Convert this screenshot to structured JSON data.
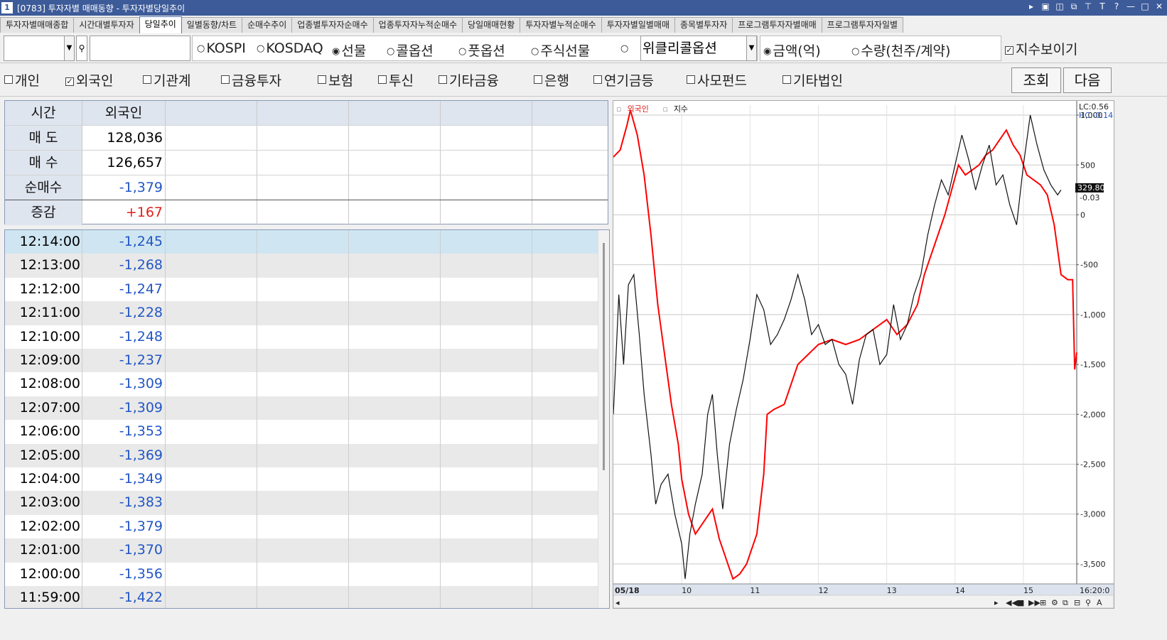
{
  "window": {
    "icon_label": "1",
    "title": "[0783] 투자자별 매매동향 - 투자자별당일추이",
    "controls": [
      "▸",
      "▣",
      "◫",
      "⧉",
      "⊤",
      "T",
      "?",
      "—",
      "□",
      "✕"
    ]
  },
  "tabs": [
    "투자자별매매종합",
    "시간대별투자자",
    "당일추이",
    "일별동향/차트",
    "순매수추이",
    "업종별투자자순매수",
    "업종투자자누적순매수",
    "당일매매현황",
    "투자자별누적순매수",
    "투자자별일별매매",
    "종목별투자자",
    "프로그램투자자별매매",
    "프로그램투자자일별"
  ],
  "active_tab": 2,
  "market": {
    "code_value": "",
    "name_value": "",
    "options": [
      "KOSPI",
      "KOSDAQ",
      "선물",
      "콜옵션",
      "풋옵션",
      "주식선물",
      ""
    ],
    "selected": "선물",
    "product_select": "위클리콜옵션",
    "unit_options": [
      "금액(억)",
      "수량(천주/계약)"
    ],
    "unit_selected": "금액(억)",
    "show_index_label": "지수보이기",
    "show_index_checked": true
  },
  "investors": {
    "items": [
      {
        "label": "개인",
        "checked": false
      },
      {
        "label": "외국인",
        "checked": true
      },
      {
        "label": "기관계",
        "checked": false
      },
      {
        "label": "금융투자",
        "checked": false
      },
      {
        "label": "보험",
        "checked": false
      },
      {
        "label": "투신",
        "checked": false
      },
      {
        "label": "기타금융",
        "checked": false
      },
      {
        "label": "은행",
        "checked": false
      },
      {
        "label": "연기금등",
        "checked": false
      },
      {
        "label": "사모펀드",
        "checked": false
      },
      {
        "label": "기타법인",
        "checked": false
      }
    ],
    "query_button": "조회",
    "next_button": "다음"
  },
  "summary": {
    "header": [
      "시간",
      "외국인"
    ],
    "rows": [
      {
        "label": "매 도",
        "value": "128,036"
      },
      {
        "label": "매 수",
        "value": "126,657"
      },
      {
        "label": "순매수",
        "value": "-1,379"
      },
      {
        "label": "증감",
        "value": "+167"
      }
    ]
  },
  "timeseries": [
    {
      "time": "12:14:00",
      "value": "-1,245"
    },
    {
      "time": "12:13:00",
      "value": "-1,268"
    },
    {
      "time": "12:12:00",
      "value": "-1,247"
    },
    {
      "time": "12:11:00",
      "value": "-1,228"
    },
    {
      "time": "12:10:00",
      "value": "-1,248"
    },
    {
      "time": "12:09:00",
      "value": "-1,237"
    },
    {
      "time": "12:08:00",
      "value": "-1,309"
    },
    {
      "time": "12:07:00",
      "value": "-1,309"
    },
    {
      "time": "12:06:00",
      "value": "-1,353"
    },
    {
      "time": "12:05:00",
      "value": "-1,369"
    },
    {
      "time": "12:04:00",
      "value": "-1,349"
    },
    {
      "time": "12:03:00",
      "value": "-1,383"
    },
    {
      "time": "12:02:00",
      "value": "-1,379"
    },
    {
      "time": "12:01:00",
      "value": "-1,370"
    },
    {
      "time": "12:00:00",
      "value": "-1,356"
    },
    {
      "time": "11:59:00",
      "value": "-1,422"
    }
  ],
  "colors": {
    "foreign": "#ff0000",
    "index": "#111111",
    "negative": "#2256c4",
    "positive": "#e0201c"
  },
  "chart_data": {
    "type": "line",
    "legend": [
      "외국인",
      "지수"
    ],
    "top_labels": [
      "LC:0.56",
      "HC:-0.14"
    ],
    "current_tags": [
      "329.80",
      "-0.03"
    ],
    "yticks": [
      1000,
      500,
      0,
      -500,
      -1000,
      -1500,
      -2000,
      -2500,
      -3000,
      -3500
    ],
    "ytick_labels": [
      "1,000",
      "500",
      "0",
      "-500",
      "-1,000",
      "-1,500",
      "-2,000",
      "-2,500",
      "-3,000",
      "-3,500"
    ],
    "ylim": [
      -3700,
      1100
    ],
    "xticks": [
      "05/18",
      "10",
      "11",
      "12",
      "13",
      "14",
      "15"
    ],
    "x_end_label": "16:20:0",
    "xlim": [
      9.0,
      15.78
    ],
    "series": [
      {
        "name": "외국인",
        "color": "#ff0000",
        "points": [
          [
            9.0,
            580
          ],
          [
            9.1,
            650
          ],
          [
            9.2,
            900
          ],
          [
            9.25,
            1050
          ],
          [
            9.35,
            800
          ],
          [
            9.45,
            400
          ],
          [
            9.55,
            -200
          ],
          [
            9.65,
            -900
          ],
          [
            9.75,
            -1400
          ],
          [
            9.85,
            -1900
          ],
          [
            9.95,
            -2300
          ],
          [
            10.0,
            -2650
          ],
          [
            10.1,
            -3000
          ],
          [
            10.2,
            -3200
          ],
          [
            10.25,
            -3150
          ],
          [
            10.35,
            -3050
          ],
          [
            10.45,
            -2950
          ],
          [
            10.55,
            -3250
          ],
          [
            10.65,
            -3450
          ],
          [
            10.75,
            -3650
          ],
          [
            10.85,
            -3600
          ],
          [
            10.95,
            -3500
          ],
          [
            11.1,
            -3200
          ],
          [
            11.2,
            -2600
          ],
          [
            11.25,
            -2000
          ],
          [
            11.35,
            -1950
          ],
          [
            11.5,
            -1900
          ],
          [
            11.6,
            -1700
          ],
          [
            11.7,
            -1500
          ],
          [
            11.85,
            -1400
          ],
          [
            12.0,
            -1300
          ],
          [
            12.2,
            -1250
          ],
          [
            12.4,
            -1300
          ],
          [
            12.6,
            -1250
          ],
          [
            12.8,
            -1150
          ],
          [
            13.0,
            -1050
          ],
          [
            13.15,
            -1200
          ],
          [
            13.3,
            -1100
          ],
          [
            13.45,
            -900
          ],
          [
            13.55,
            -600
          ],
          [
            13.65,
            -400
          ],
          [
            13.75,
            -200
          ],
          [
            13.85,
            0
          ],
          [
            13.95,
            250
          ],
          [
            14.05,
            500
          ],
          [
            14.15,
            400
          ],
          [
            14.25,
            450
          ],
          [
            14.35,
            500
          ],
          [
            14.45,
            600
          ],
          [
            14.55,
            650
          ],
          [
            14.65,
            750
          ],
          [
            14.75,
            850
          ],
          [
            14.85,
            700
          ],
          [
            14.95,
            600
          ],
          [
            15.05,
            400
          ],
          [
            15.15,
            350
          ],
          [
            15.25,
            300
          ],
          [
            15.35,
            200
          ],
          [
            15.45,
            -100
          ],
          [
            15.55,
            -600
          ],
          [
            15.65,
            -650
          ],
          [
            15.72,
            -650
          ],
          [
            15.75,
            -1550
          ],
          [
            15.78,
            -1380
          ]
        ]
      },
      {
        "name": "지수",
        "color": "#111111",
        "points": [
          [
            9.0,
            -2000
          ],
          [
            9.08,
            -800
          ],
          [
            9.15,
            -1500
          ],
          [
            9.22,
            -700
          ],
          [
            9.3,
            -600
          ],
          [
            9.38,
            -1200
          ],
          [
            9.45,
            -1800
          ],
          [
            9.55,
            -2400
          ],
          [
            9.62,
            -2900
          ],
          [
            9.7,
            -2700
          ],
          [
            9.8,
            -2600
          ],
          [
            9.9,
            -3000
          ],
          [
            10.0,
            -3300
          ],
          [
            10.05,
            -3650
          ],
          [
            10.12,
            -3200
          ],
          [
            10.2,
            -2900
          ],
          [
            10.3,
            -2600
          ],
          [
            10.38,
            -2000
          ],
          [
            10.45,
            -1800
          ],
          [
            10.52,
            -2400
          ],
          [
            10.6,
            -2950
          ],
          [
            10.7,
            -2300
          ],
          [
            10.8,
            -1950
          ],
          [
            10.9,
            -1650
          ],
          [
            11.0,
            -1250
          ],
          [
            11.1,
            -800
          ],
          [
            11.2,
            -950
          ],
          [
            11.3,
            -1300
          ],
          [
            11.4,
            -1200
          ],
          [
            11.5,
            -1050
          ],
          [
            11.6,
            -850
          ],
          [
            11.7,
            -600
          ],
          [
            11.8,
            -850
          ],
          [
            11.9,
            -1200
          ],
          [
            12.0,
            -1100
          ],
          [
            12.1,
            -1300
          ],
          [
            12.2,
            -1250
          ],
          [
            12.3,
            -1500
          ],
          [
            12.4,
            -1600
          ],
          [
            12.5,
            -1900
          ],
          [
            12.6,
            -1450
          ],
          [
            12.7,
            -1200
          ],
          [
            12.8,
            -1150
          ],
          [
            12.9,
            -1500
          ],
          [
            13.0,
            -1400
          ],
          [
            13.1,
            -900
          ],
          [
            13.2,
            -1250
          ],
          [
            13.3,
            -1100
          ],
          [
            13.4,
            -800
          ],
          [
            13.5,
            -600
          ],
          [
            13.6,
            -200
          ],
          [
            13.7,
            100
          ],
          [
            13.8,
            350
          ],
          [
            13.9,
            200
          ],
          [
            14.0,
            500
          ],
          [
            14.1,
            800
          ],
          [
            14.2,
            550
          ],
          [
            14.3,
            250
          ],
          [
            14.4,
            500
          ],
          [
            14.5,
            700
          ],
          [
            14.6,
            300
          ],
          [
            14.7,
            400
          ],
          [
            14.8,
            100
          ],
          [
            14.9,
            -100
          ],
          [
            15.0,
            500
          ],
          [
            15.1,
            1000
          ],
          [
            15.2,
            700
          ],
          [
            15.3,
            450
          ],
          [
            15.4,
            300
          ],
          [
            15.5,
            200
          ],
          [
            15.55,
            250
          ]
        ]
      }
    ]
  }
}
